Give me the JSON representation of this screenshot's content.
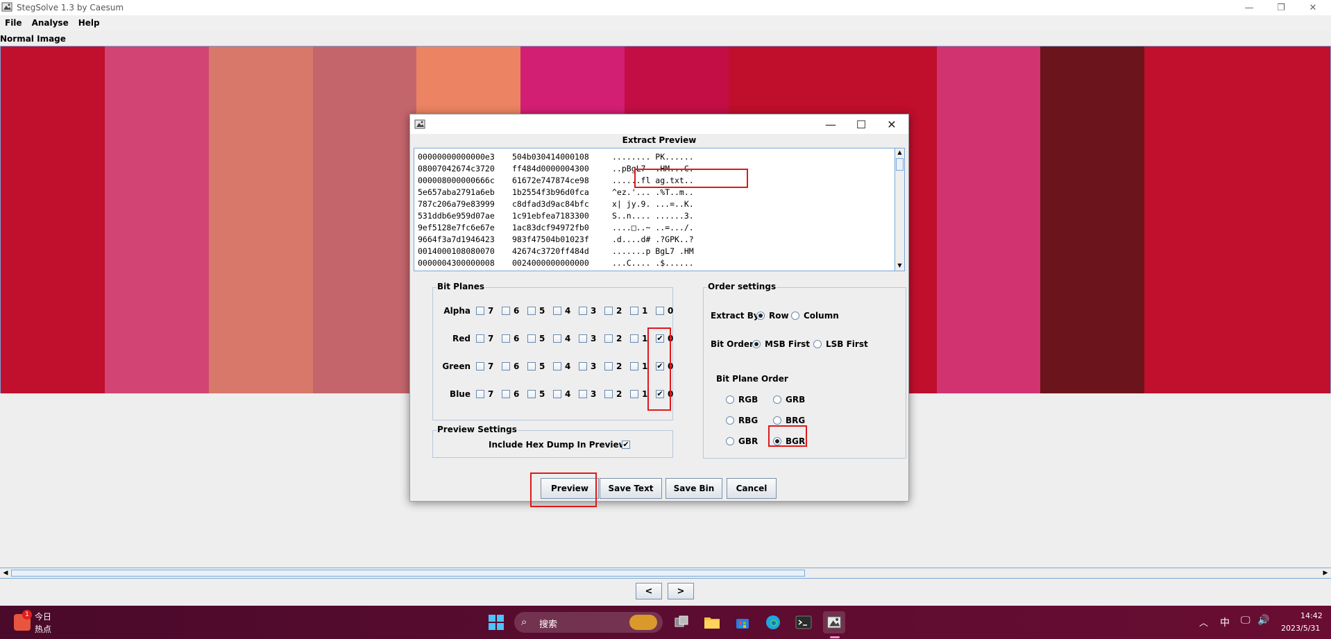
{
  "window": {
    "title": "StegSolve 1.3 by Caesum",
    "minimize": "—",
    "maximize": "❐",
    "close": "✕"
  },
  "menu": [
    "File",
    "Analyse",
    "Help"
  ],
  "image_label": "Normal Image",
  "stripe_colors": [
    "#c0102e",
    "#d14473",
    "#d7786a",
    "#c4656c",
    "#ec8362",
    "#d21f73",
    "#c20e45",
    "#c00e2d",
    "#c00e2d",
    "#d0336f",
    "#6c141b",
    "#c0102e",
    "#c0102e"
  ],
  "nav": {
    "prev": "<",
    "next": ">"
  },
  "dialog": {
    "min": "—",
    "max": "☐",
    "close": "✕",
    "heading": "Extract Preview",
    "hex_rows": [
      [
        "00000000000000e3",
        "504b030414000108",
        "........ PK......"
      ],
      [
        "08007042674c3720",
        "ff484d0000004300",
        "..pBgL7  .HM...C."
      ],
      [
        "000008000000666c",
        "61672e747874ce98",
        "......fl ag.txt.."
      ],
      [
        "5e657aba2791a6eb",
        "1b2554f3b96d0fca",
        "^ez.'... .%T..m.."
      ],
      [
        "787c206a79e83999",
        "c8dfad3d9ac84bfc",
        "x| jy.9. ...=..K."
      ],
      [
        "531ddb6e959d07ae",
        "1c91ebfea7183300",
        "S..n.... ......3."
      ],
      [
        "9ef5128e7fc6e67e",
        "1ac83dcf94972fb0",
        "....□..~ ..=.../."
      ],
      [
        "9664f3a7d1946423",
        "983f47504b01023f",
        ".d....d# .?GPK..?"
      ],
      [
        "0014000108080070",
        "42674c3720ff484d",
        ".......p BgL7 .HM"
      ],
      [
        "0000004300000008",
        "0024000000000000",
        "...C.... .$......"
      ]
    ],
    "bit_planes": {
      "title": "Bit Planes",
      "rows": [
        {
          "label": "Alpha",
          "checked": [
            false,
            false,
            false,
            false,
            false,
            false,
            false,
            false
          ]
        },
        {
          "label": "Red",
          "checked": [
            false,
            false,
            false,
            false,
            false,
            false,
            false,
            true
          ]
        },
        {
          "label": "Green",
          "checked": [
            false,
            false,
            false,
            false,
            false,
            false,
            false,
            true
          ]
        },
        {
          "label": "Blue",
          "checked": [
            false,
            false,
            false,
            false,
            false,
            false,
            false,
            true
          ]
        }
      ],
      "bits": [
        "7",
        "6",
        "5",
        "4",
        "3",
        "2",
        "1",
        "0"
      ]
    },
    "preview_settings": {
      "title": "Preview Settings",
      "include_hex_label": "Include Hex Dump In Preview",
      "include_hex_checked": true
    },
    "order_settings": {
      "title": "Order settings",
      "extract_by_label": "Extract By",
      "extract_by_options": [
        "Row",
        "Column"
      ],
      "extract_by_selected": "Row",
      "bit_order_label": "Bit Order",
      "bit_order_options": [
        "MSB First",
        "LSB First"
      ],
      "bit_order_selected": "MSB First",
      "plane_order_label": "Bit Plane Order",
      "plane_order_options": [
        "RGB",
        "GRB",
        "RBG",
        "BRG",
        "GBR",
        "BGR"
      ],
      "plane_order_selected": "BGR"
    },
    "buttons": {
      "preview": "Preview",
      "save_text": "Save Text",
      "save_bin": "Save Bin",
      "cancel": "Cancel"
    }
  },
  "taskbar": {
    "widget_title": "今日",
    "widget_sub": "热点",
    "widget_badge": "1",
    "search_label": "搜索",
    "ime": "中",
    "time": "14:42",
    "date": "2023/5/31"
  }
}
